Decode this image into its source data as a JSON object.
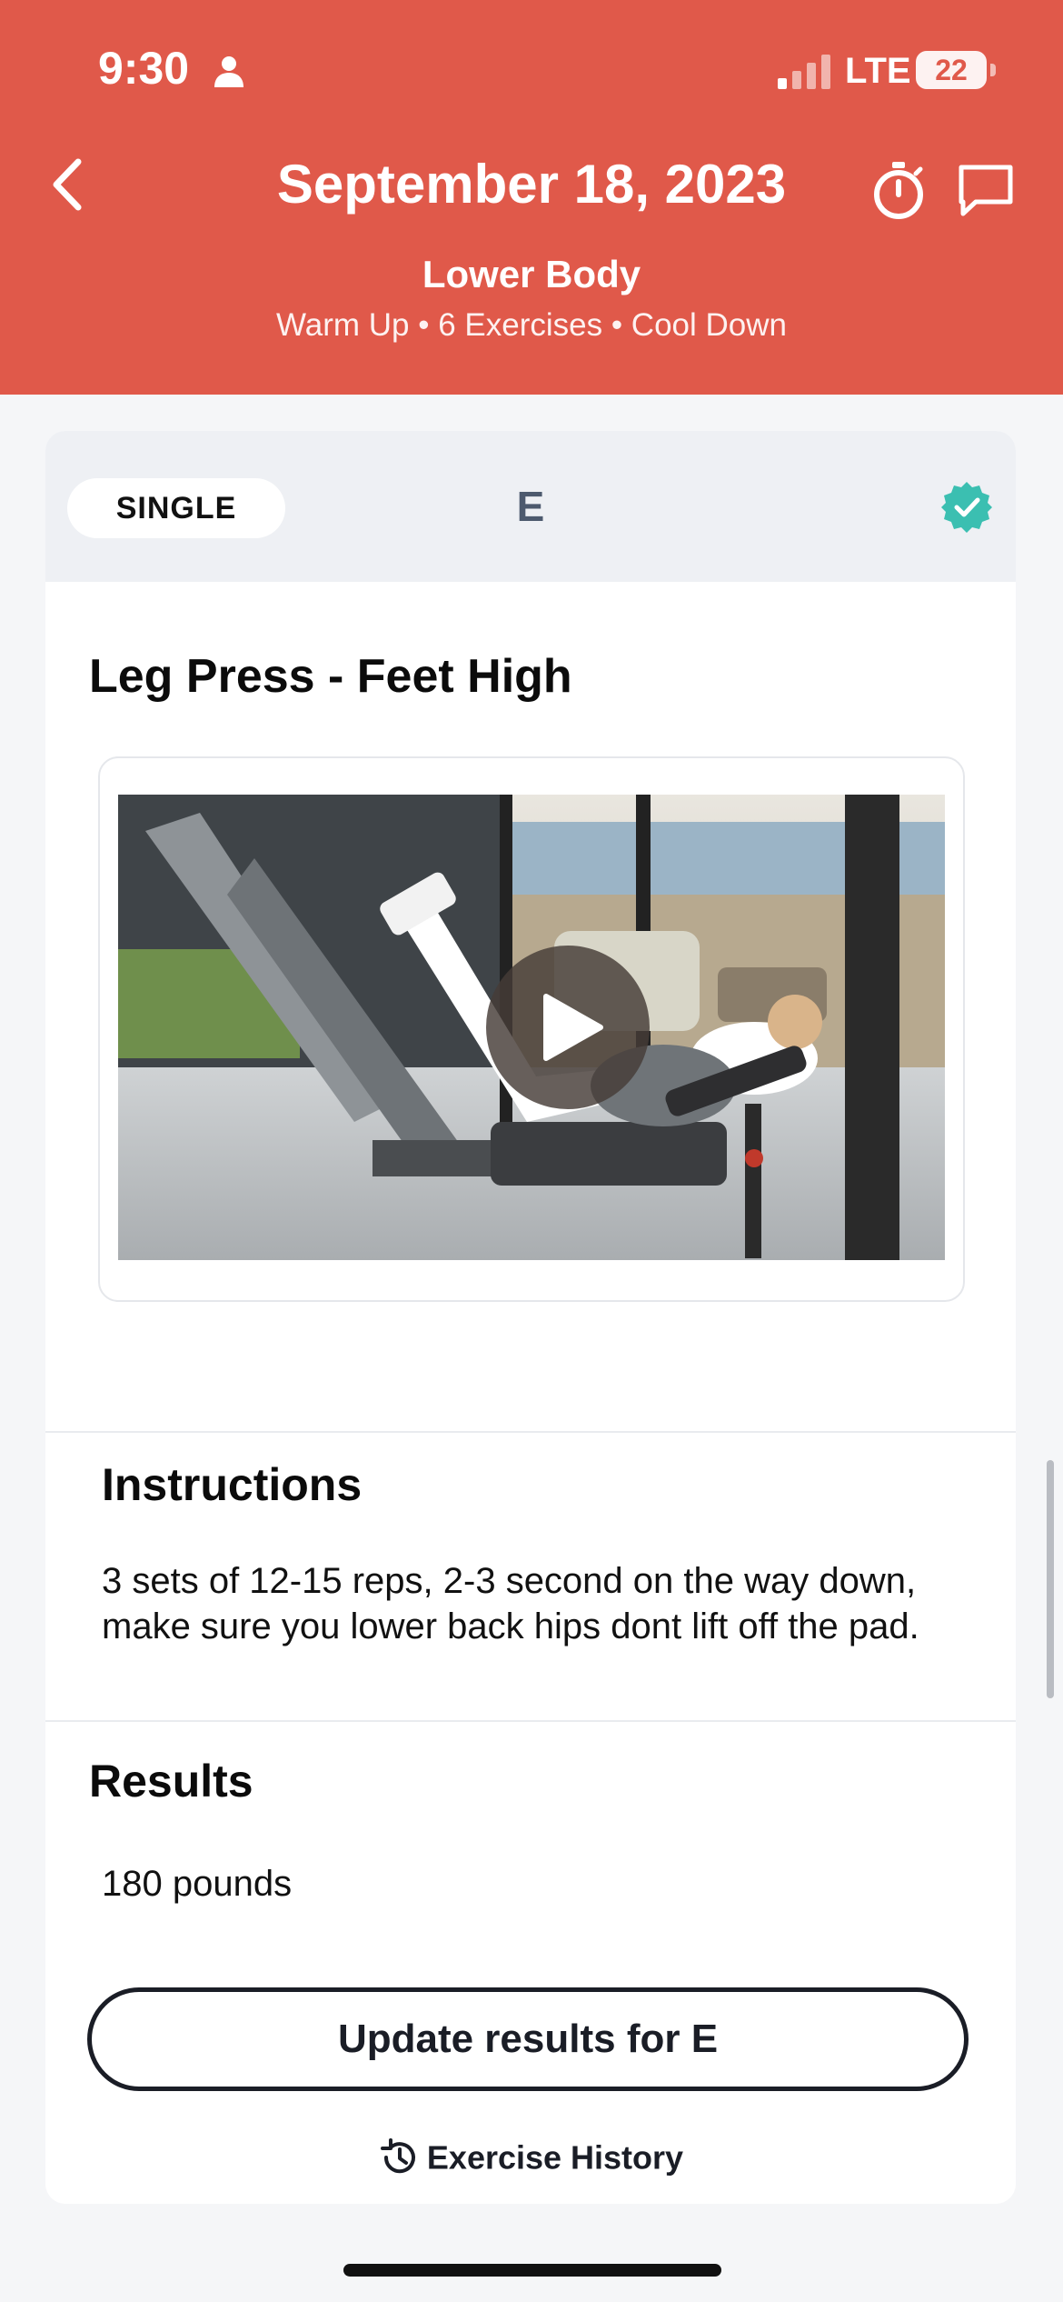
{
  "status_bar": {
    "time": "9:30",
    "network": "LTE",
    "battery": "22",
    "icons": [
      "person-icon",
      "signal-icon",
      "battery-icon"
    ]
  },
  "header": {
    "date": "September 18, 2023",
    "workout_name": "Lower Body",
    "workout_summary": "Warm Up • 6 Exercises • Cool Down",
    "icons": [
      "back-chevron-icon",
      "stopwatch-icon",
      "chat-icon"
    ],
    "background_color": "#e0594a"
  },
  "card": {
    "type_label": "SINGLE",
    "exercise_letter": "E",
    "completed_badge_color": "#3bbfb1",
    "exercise_title": "Leg Press - Feet High",
    "video": {
      "icon": "play-icon"
    },
    "instructions_heading": "Instructions",
    "instructions_text": "3 sets of 12-15 reps, 2-3 second on the way down, make sure you lower back hips dont lift off the pad.",
    "results_heading": "Results",
    "results_value": "180 pounds",
    "update_button_label": "Update results for E",
    "history_link_label": "Exercise History"
  }
}
